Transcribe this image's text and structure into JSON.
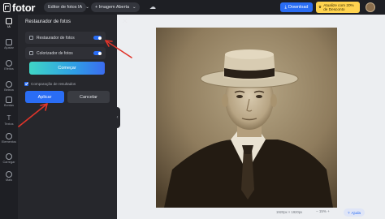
{
  "app": {
    "logo_text": "fotor",
    "editor_tab": "Editor de fotos IA",
    "open_image": "+ Imagem Aberta",
    "download": "Download",
    "upgrade_line1": "Atualize com 20%",
    "upgrade_line2": "de Desconto"
  },
  "rail": [
    {
      "label": "IA"
    },
    {
      "label": "Ajustar"
    },
    {
      "label": "Efeitos"
    },
    {
      "label": "Beleza"
    },
    {
      "label": "Bordas"
    },
    {
      "label": "Textos"
    },
    {
      "label": "Elementos"
    },
    {
      "label": "Carregar"
    },
    {
      "label": "Mais"
    }
  ],
  "panel": {
    "title": "Restaurador de fotos",
    "close": "✕",
    "option1": "Restaurador de fotos",
    "option2": "Colorizador de fotos",
    "start": "Começar",
    "compare": "Comparação de resultados",
    "apply": "Aplicar",
    "cancel": "Cancelar",
    "collapse": "‹"
  },
  "status": {
    "size": "1920px × 1920px",
    "zoom": "15%",
    "help": "Ajuda"
  },
  "colors": {
    "accent": "#2a6df4",
    "dark_bg": "#1e1f24",
    "panel_bg": "#26272c",
    "annotation": "#e0342a"
  }
}
